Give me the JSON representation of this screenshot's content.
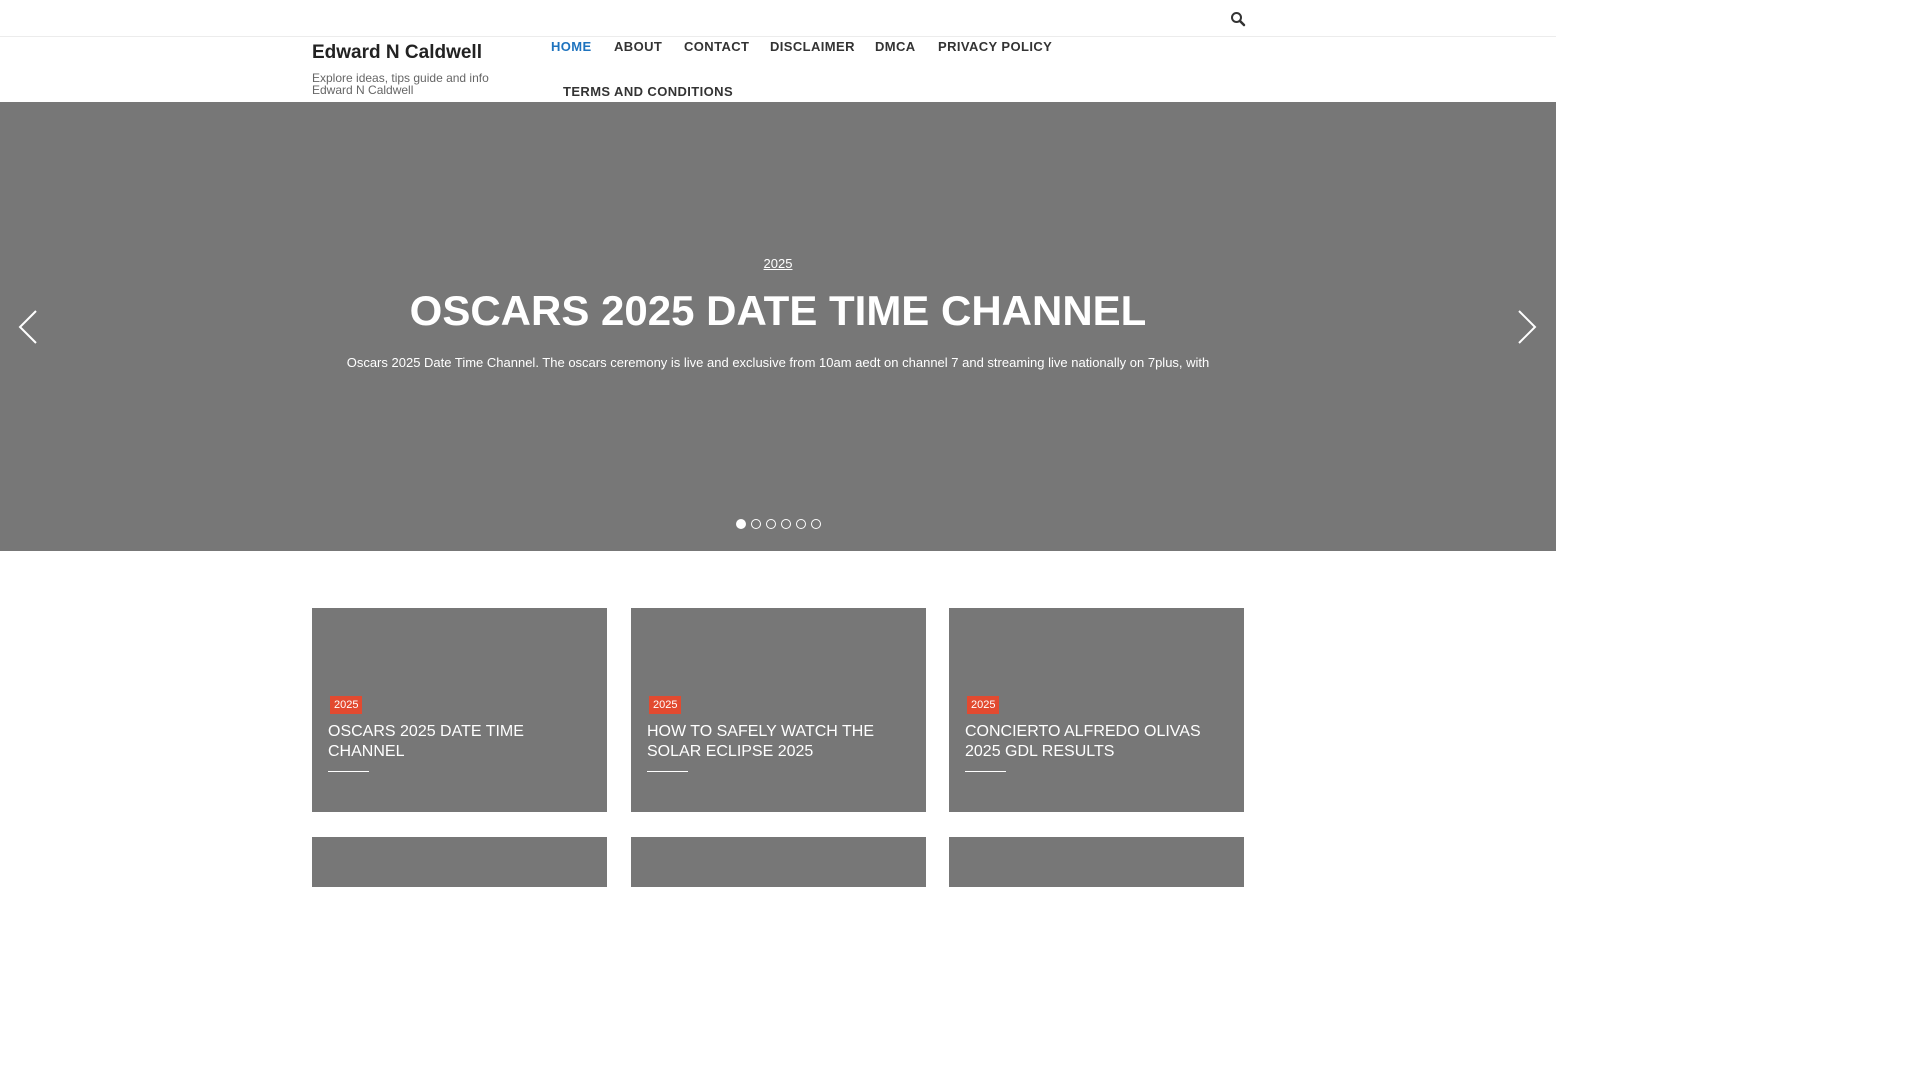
{
  "site": {
    "title": "Edward N Caldwell",
    "tagline": "Explore ideas, tips guide and info Edward N Caldwell"
  },
  "nav": [
    {
      "label": "HOME",
      "active": true
    },
    {
      "label": "ABOUT"
    },
    {
      "label": "CONTACT"
    },
    {
      "label": "DISCLAIMER"
    },
    {
      "label": "DMCA"
    },
    {
      "label": "PRIVACY POLICY"
    },
    {
      "label": "TERMS AND CONDITIONS"
    }
  ],
  "search": {
    "icon": "search-icon"
  },
  "slider": {
    "category": "2025",
    "title": "OSCARS 2025 DATE TIME CHANNEL",
    "excerpt": "Oscars 2025 Date Time Channel. The oscars ceremony is live and exclusive from 10am aedt on channel 7 and streaming live nationally on 7plus, with",
    "dot_count": 6,
    "active_dot": 1,
    "prev_icon": "chevron-left-icon",
    "next_icon": "chevron-right-icon"
  },
  "posts": [
    {
      "category": "2025",
      "title": "OSCARS 2025 DATE TIME CHANNEL"
    },
    {
      "category": "2025",
      "title": "HOW TO SAFELY WATCH THE SOLAR ECLIPSE 2025"
    },
    {
      "category": "2025",
      "title": "CONCIERTO ALFREDO OLIVAS 2025 GDL RESULTS"
    }
  ],
  "colors": {
    "accent": "#1e73be",
    "badge": "#e24a30",
    "placeholder_bg": "#777777"
  }
}
